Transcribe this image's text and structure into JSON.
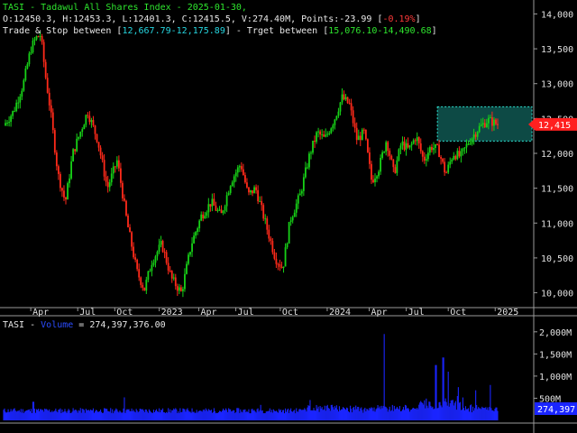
{
  "header": {
    "symbol": "TASI",
    "sep": " - ",
    "name": "Tadawul All Shares Index",
    "date": "2025-01-30,",
    "ohlc": "O:12450.3, H:12453.3, L:12401.3, C:12415.5, V:274.40M, Points:-23.99 [",
    "change": "-0.19%",
    "close_br": "]",
    "trade_label": "Trade & Stop between [",
    "trade_range": "12,667.79-12,175.89",
    "trade_mid": "] - Trget between [",
    "target_range": "15,076.10-14,490.68",
    "target_end": "]",
    "volume_symbol": "TASI - ",
    "volume_label": "Volume",
    "volume_value": " = 274,397,376.00"
  },
  "colors": {
    "up": "#17d117",
    "down": "#ff2a1a",
    "box_fill": "#0d4a45",
    "box_border": "#2ee0d0",
    "volume": "#1a25ff",
    "price_tag": "#ff2020",
    "volume_tag": "#1a25ff"
  },
  "chart_data": [
    {
      "type": "candlestick",
      "title": "TASI - Tadawul All Shares Index",
      "ylim": [
        9800,
        14200
      ],
      "y_ticks": [
        "14,000",
        "13,500",
        "13,000",
        "12,500",
        "12,000",
        "11,500",
        "11,000",
        "10,500",
        "10,000"
      ],
      "x_ticks": [
        "Apr",
        "Jul",
        "Oct",
        "2023",
        "Apr",
        "Jul",
        "Oct",
        "2024",
        "Apr",
        "Jul",
        "Oct",
        "2025"
      ],
      "last_price_label": "12,415",
      "trade_zone": {
        "high": 12667.79,
        "low": 12175.89
      },
      "close_path": [
        {
          "t": 0,
          "v": 12400
        },
        {
          "t": 0.02,
          "v": 12600
        },
        {
          "t": 0.04,
          "v": 13000
        },
        {
          "t": 0.055,
          "v": 13500
        },
        {
          "t": 0.065,
          "v": 13650
        },
        {
          "t": 0.075,
          "v": 13700
        },
        {
          "t": 0.085,
          "v": 13100
        },
        {
          "t": 0.095,
          "v": 12600
        },
        {
          "t": 0.11,
          "v": 11700
        },
        {
          "t": 0.125,
          "v": 11300
        },
        {
          "t": 0.14,
          "v": 12000
        },
        {
          "t": 0.155,
          "v": 12300
        },
        {
          "t": 0.17,
          "v": 12600
        },
        {
          "t": 0.19,
          "v": 12200
        },
        {
          "t": 0.21,
          "v": 11500
        },
        {
          "t": 0.23,
          "v": 11900
        },
        {
          "t": 0.25,
          "v": 11000
        },
        {
          "t": 0.27,
          "v": 10300
        },
        {
          "t": 0.285,
          "v": 10050
        },
        {
          "t": 0.3,
          "v": 10450
        },
        {
          "t": 0.32,
          "v": 10700
        },
        {
          "t": 0.34,
          "v": 10200
        },
        {
          "t": 0.36,
          "v": 10000
        },
        {
          "t": 0.38,
          "v": 10700
        },
        {
          "t": 0.4,
          "v": 11100
        },
        {
          "t": 0.42,
          "v": 11300
        },
        {
          "t": 0.44,
          "v": 11100
        },
        {
          "t": 0.46,
          "v": 11600
        },
        {
          "t": 0.48,
          "v": 11850
        },
        {
          "t": 0.495,
          "v": 11400
        },
        {
          "t": 0.51,
          "v": 11500
        },
        {
          "t": 0.53,
          "v": 11000
        },
        {
          "t": 0.55,
          "v": 10500
        },
        {
          "t": 0.565,
          "v": 10350
        },
        {
          "t": 0.58,
          "v": 11050
        },
        {
          "t": 0.6,
          "v": 11400
        },
        {
          "t": 0.62,
          "v": 12000
        },
        {
          "t": 0.635,
          "v": 12300
        },
        {
          "t": 0.65,
          "v": 12200
        },
        {
          "t": 0.67,
          "v": 12500
        },
        {
          "t": 0.685,
          "v": 12800
        },
        {
          "t": 0.7,
          "v": 12700
        },
        {
          "t": 0.715,
          "v": 12200
        },
        {
          "t": 0.73,
          "v": 12300
        },
        {
          "t": 0.745,
          "v": 11600
        },
        {
          "t": 0.76,
          "v": 11800
        },
        {
          "t": 0.775,
          "v": 12200
        },
        {
          "t": 0.79,
          "v": 11700
        },
        {
          "t": 0.805,
          "v": 12150
        },
        {
          "t": 0.82,
          "v": 12050
        },
        {
          "t": 0.835,
          "v": 12250
        },
        {
          "t": 0.85,
          "v": 11900
        },
        {
          "t": 0.865,
          "v": 12100
        },
        {
          "t": 0.88,
          "v": 12050
        },
        {
          "t": 0.895,
          "v": 11700
        },
        {
          "t": 0.91,
          "v": 12000
        },
        {
          "t": 0.925,
          "v": 11950
        },
        {
          "t": 0.94,
          "v": 12150
        },
        {
          "t": 0.96,
          "v": 12350
        },
        {
          "t": 0.98,
          "v": 12480
        },
        {
          "t": 1.0,
          "v": 12415
        }
      ]
    },
    {
      "type": "bar",
      "title": "TASI - Volume",
      "ylim": [
        0,
        2200
      ],
      "y_ticks": [
        "2,000M",
        "1,500M",
        "1,000M",
        "500M"
      ],
      "last_value_label": "274,397",
      "spikes": [
        {
          "t": 0.06,
          "v": 420
        },
        {
          "t": 0.245,
          "v": 520
        },
        {
          "t": 0.52,
          "v": 350
        },
        {
          "t": 0.62,
          "v": 460
        },
        {
          "t": 0.77,
          "v": 1950
        },
        {
          "t": 0.875,
          "v": 1250
        },
        {
          "t": 0.89,
          "v": 1420
        },
        {
          "t": 0.9,
          "v": 1100
        },
        {
          "t": 0.92,
          "v": 750
        },
        {
          "t": 0.955,
          "v": 680
        },
        {
          "t": 0.985,
          "v": 800
        }
      ]
    }
  ]
}
